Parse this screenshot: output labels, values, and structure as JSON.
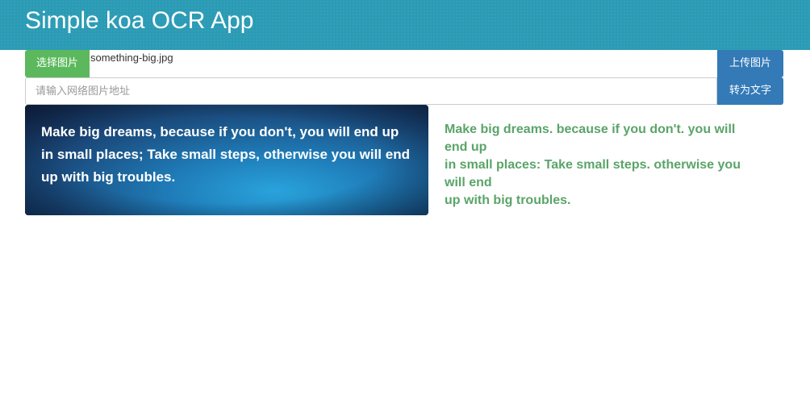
{
  "header": {
    "title": "Simple koa OCR App"
  },
  "upload_row": {
    "choose_label": "选择图片",
    "file_name": "something-big.jpg",
    "upload_label": "上传图片"
  },
  "url_row": {
    "placeholder": "请输入网络图片地址",
    "convert_label": "转为文字"
  },
  "image": {
    "text_lines": [
      "Make big dreams, because if you don't, you will end up",
      "in small places; Take small steps, otherwise you will end",
      "up with big troubles."
    ]
  },
  "result": {
    "lines": [
      "Make big dreams. because if you don't. you will",
      "end up",
      "in small places: Take small steps. otherwise you",
      "will end",
      "up with big troubles."
    ]
  },
  "colors": {
    "header_bg": "#2b9bb5",
    "success_button": "#5cb85c",
    "primary_button": "#337ab7",
    "result_text": "#5aa469"
  }
}
